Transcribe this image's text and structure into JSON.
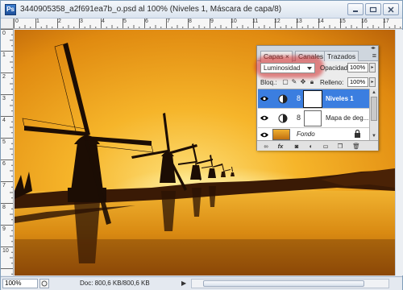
{
  "window": {
    "app_icon": "Ps",
    "title": "3440905358_a2f691ea7b_o.psd al 100% (Niveles 1, Máscara de capa/8)",
    "controls": [
      "minimize-icon",
      "restore-icon",
      "close-icon"
    ]
  },
  "rulers": {
    "horizontal": [
      "0",
      "1",
      "2",
      "3",
      "4",
      "5",
      "6",
      "7",
      "8",
      "9",
      "10",
      "11",
      "12",
      "13",
      "14",
      "15",
      "16",
      "17"
    ],
    "vertical": [
      "0",
      "1",
      "2",
      "3",
      "4",
      "5",
      "6",
      "7",
      "8",
      "9",
      "10"
    ]
  },
  "status": {
    "zoom": "100%",
    "doc_info": "Doc: 800,6 KB/800,6 KB"
  },
  "layers_panel": {
    "tabs": [
      {
        "label": "Capas ×",
        "active": true
      },
      {
        "label": "Canales",
        "active": false
      },
      {
        "label": "Trazados",
        "active": false
      }
    ],
    "menu_icon": "panel-menu-icon",
    "blend_mode": "Luminosidad",
    "opacity_label": "Opacidad:",
    "opacity_value": "100%",
    "lock_label": "Bloq.:",
    "fill_label": "Relleno:",
    "fill_value": "100%",
    "highlight_color": "#d22828",
    "selection_color": "#3b7ee0",
    "layers": [
      {
        "name": "Niveles 1",
        "selected": true,
        "type": "adjustment",
        "visible": true
      },
      {
        "name": "Mapa de deg...",
        "selected": false,
        "type": "adjustment",
        "visible": true
      },
      {
        "name": "Fondo",
        "selected": false,
        "type": "background",
        "visible": true,
        "locked": true
      }
    ],
    "bottom_icons": [
      "link-icon",
      "fx-icon",
      "mask-icon",
      "adjustment-icon",
      "folder-icon",
      "new-layer-icon",
      "trash-icon"
    ],
    "bottom_labels": {
      "fx": "fx"
    }
  },
  "canvas": {
    "subject": "windmills at sunset",
    "sky_color": "#f0a818",
    "water_color": "#c87808"
  }
}
